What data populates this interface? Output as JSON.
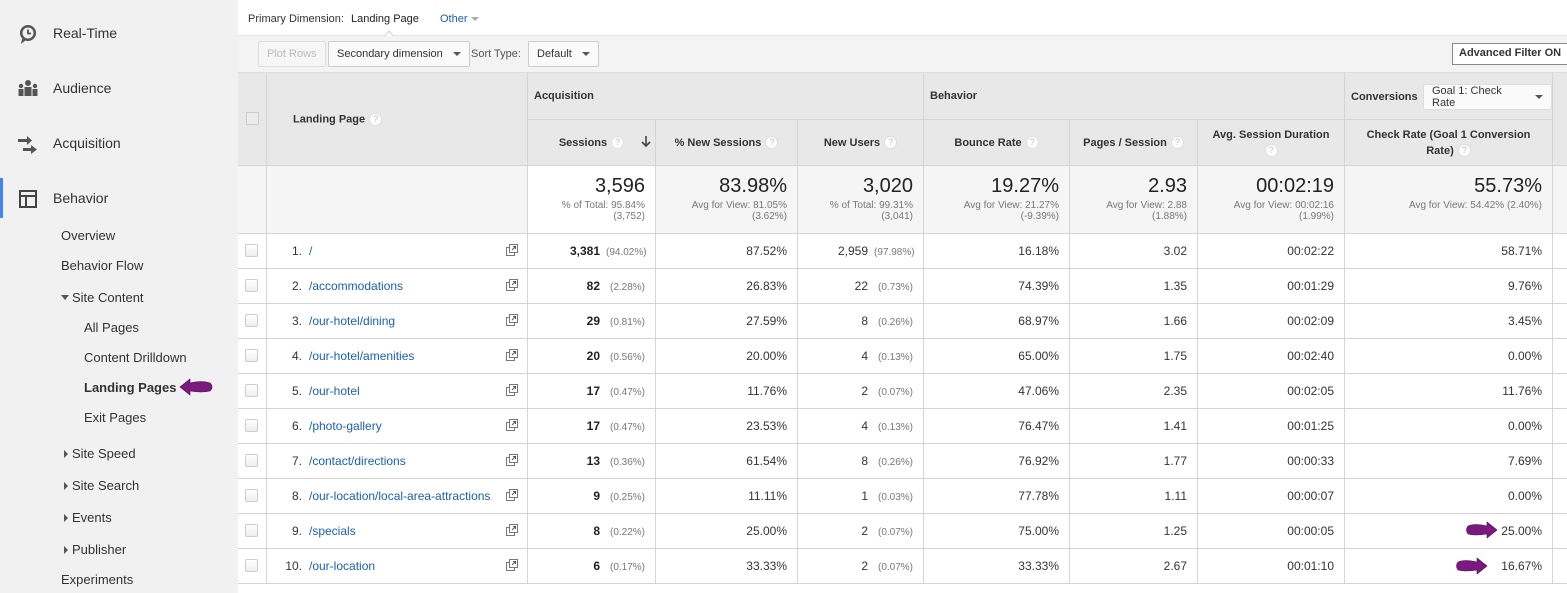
{
  "sidebar": {
    "top_items": [
      {
        "label": "Real-Time",
        "icon": "clock-icon"
      },
      {
        "label": "Audience",
        "icon": "people-icon"
      },
      {
        "label": "Acquisition",
        "icon": "arrows-icon"
      },
      {
        "label": "Behavior",
        "icon": "layout-icon",
        "active": true
      }
    ],
    "behavior_items": {
      "overview": "Overview",
      "behavior_flow": "Behavior Flow",
      "site_content": "Site Content",
      "all_pages": "All Pages",
      "content_drilldown": "Content Drilldown",
      "landing_pages": "Landing Pages",
      "exit_pages": "Exit Pages",
      "site_speed": "Site Speed",
      "site_search": "Site Search",
      "events": "Events",
      "publisher": "Publisher",
      "experiments": "Experiments"
    },
    "annotation_color": "#7b1a7e"
  },
  "primary_dimension": {
    "label": "Primary Dimension:",
    "value": "Landing Page",
    "other": "Other"
  },
  "toolbar": {
    "plot_rows": "Plot Rows",
    "secondary_dimension": "Secondary dimension",
    "sort_type_label": "Sort Type:",
    "sort_type_value": "Default",
    "advanced_filter": "Advanced Filter ON"
  },
  "table": {
    "dimension_header": "Landing Page",
    "groups": {
      "acquisition": "Acquisition",
      "behavior": "Behavior",
      "conversions": "Conversions",
      "goal_select": "Goal 1: Check Rate"
    },
    "columns": {
      "sessions": "Sessions",
      "new_sessions": "% New Sessions",
      "new_users": "New Users",
      "bounce_rate": "Bounce Rate",
      "pages_session": "Pages / Session",
      "avg_duration": "Avg. Session Duration",
      "check_rate_1": "Check Rate (Goal 1 Conversion",
      "check_rate_2": "Rate)"
    },
    "help_glyph": "?",
    "summary": {
      "sessions": {
        "value": "3,596",
        "line1": "% of Total: 95.84%",
        "line2": "(3,752)"
      },
      "new_sessions": {
        "value": "83.98%",
        "line1": "Avg for View: 81.05%",
        "line2": "(3.62%)"
      },
      "new_users": {
        "value": "3,020",
        "line1": "% of Total: 99.31%",
        "line2": "(3,041)"
      },
      "bounce_rate": {
        "value": "19.27%",
        "line1": "Avg for View: 21.27%",
        "line2": "(-9.39%)"
      },
      "pages_session": {
        "value": "2.93",
        "line1": "Avg for View: 2.88",
        "line2": "(1.88%)"
      },
      "avg_duration": {
        "value": "00:02:19",
        "line1": "Avg for View: 00:02:16",
        "line2": "(1.99%)"
      },
      "check_rate": {
        "value": "55.73%",
        "line1": "Avg for View: 54.42% (2.40%)",
        "line2": ""
      }
    },
    "rows": [
      {
        "num": "1.",
        "page": "/",
        "sessions": "3,381",
        "sessions_pct": "(94.02%)",
        "new_sessions": "87.52%",
        "new_users": "2,959",
        "new_users_pct": "(97.98%)",
        "bounce_rate": "16.18%",
        "pages_session": "3.02",
        "avg_duration": "00:02:22",
        "check_rate": "58.71%"
      },
      {
        "num": "2.",
        "page": "/accommodations",
        "sessions": "82",
        "sessions_pct": "(2.28%)",
        "new_sessions": "26.83%",
        "new_users": "22",
        "new_users_pct": "(0.73%)",
        "bounce_rate": "74.39%",
        "pages_session": "1.35",
        "avg_duration": "00:01:29",
        "check_rate": "9.76%"
      },
      {
        "num": "3.",
        "page": "/our-hotel/dining",
        "sessions": "29",
        "sessions_pct": "(0.81%)",
        "new_sessions": "27.59%",
        "new_users": "8",
        "new_users_pct": "(0.26%)",
        "bounce_rate": "68.97%",
        "pages_session": "1.66",
        "avg_duration": "00:02:09",
        "check_rate": "3.45%"
      },
      {
        "num": "4.",
        "page": "/our-hotel/amenities",
        "sessions": "20",
        "sessions_pct": "(0.56%)",
        "new_sessions": "20.00%",
        "new_users": "4",
        "new_users_pct": "(0.13%)",
        "bounce_rate": "65.00%",
        "pages_session": "1.75",
        "avg_duration": "00:02:40",
        "check_rate": "0.00%"
      },
      {
        "num": "5.",
        "page": "/our-hotel",
        "sessions": "17",
        "sessions_pct": "(0.47%)",
        "new_sessions": "11.76%",
        "new_users": "2",
        "new_users_pct": "(0.07%)",
        "bounce_rate": "47.06%",
        "pages_session": "2.35",
        "avg_duration": "00:02:05",
        "check_rate": "11.76%"
      },
      {
        "num": "6.",
        "page": "/photo-gallery",
        "sessions": "17",
        "sessions_pct": "(0.47%)",
        "new_sessions": "23.53%",
        "new_users": "4",
        "new_users_pct": "(0.13%)",
        "bounce_rate": "76.47%",
        "pages_session": "1.41",
        "avg_duration": "00:01:25",
        "check_rate": "0.00%"
      },
      {
        "num": "7.",
        "page": "/contact/directions",
        "sessions": "13",
        "sessions_pct": "(0.36%)",
        "new_sessions": "61.54%",
        "new_users": "8",
        "new_users_pct": "(0.26%)",
        "bounce_rate": "76.92%",
        "pages_session": "1.77",
        "avg_duration": "00:00:33",
        "check_rate": "7.69%"
      },
      {
        "num": "8.",
        "page": "/our-location/local-area-attractions",
        "sessions": "9",
        "sessions_pct": "(0.25%)",
        "new_sessions": "11.11%",
        "new_users": "1",
        "new_users_pct": "(0.03%)",
        "bounce_rate": "77.78%",
        "pages_session": "1.11",
        "avg_duration": "00:00:07",
        "check_rate": "0.00%"
      },
      {
        "num": "9.",
        "page": "/specials",
        "sessions": "8",
        "sessions_pct": "(0.22%)",
        "new_sessions": "25.00%",
        "new_users": "2",
        "new_users_pct": "(0.07%)",
        "bounce_rate": "75.00%",
        "pages_session": "1.25",
        "avg_duration": "00:00:05",
        "check_rate": "25.00%",
        "highlight": true
      },
      {
        "num": "10.",
        "page": "/our-location",
        "sessions": "6",
        "sessions_pct": "(0.17%)",
        "new_sessions": "33.33%",
        "new_users": "2",
        "new_users_pct": "(0.07%)",
        "bounce_rate": "33.33%",
        "pages_session": "2.67",
        "avg_duration": "00:01:10",
        "check_rate": "16.67%",
        "highlight": true
      }
    ]
  }
}
